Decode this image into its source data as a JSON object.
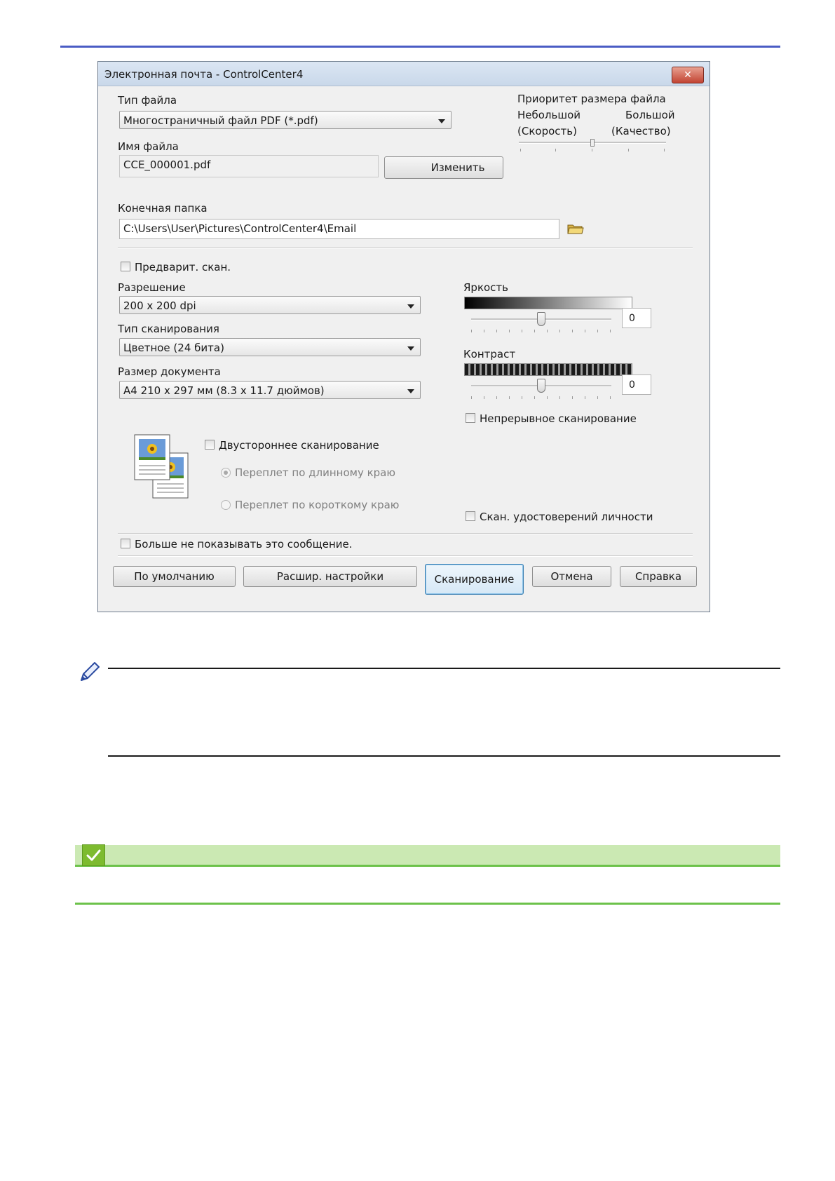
{
  "dialog": {
    "title": "Электронная почта - ControlCenter4",
    "close_label": "✕",
    "file_type": {
      "label": "Тип файла",
      "value": "Многостраничный файл PDF (*.pdf)"
    },
    "file_name": {
      "label": "Имя файла",
      "value": "CCE_000001.pdf",
      "change_button": "Изменить"
    },
    "file_size_priority": {
      "label": "Приоритет размера файла",
      "small": "Небольшой",
      "small_sub": "(Скорость)",
      "large": "Большой",
      "large_sub": "(Качество)",
      "level_fraction": 0.5
    },
    "destination": {
      "label": "Конечная папка",
      "path": "C:\\Users\\User\\Pictures\\ControlCenter4\\Email",
      "folder_icon": "folder-icon"
    },
    "prescan": {
      "label": "Предварит. скан.",
      "checked": false
    },
    "resolution": {
      "label": "Разрешение",
      "value": "200 x 200  dpi"
    },
    "scan_type": {
      "label": "Тип сканирования",
      "value": "Цветное (24 бита)"
    },
    "document_size": {
      "label": "Размер документа",
      "value": "A4 210 x 297 мм (8.3 x 11.7 дюймов)"
    },
    "brightness": {
      "label": "Яркость",
      "value": "0",
      "level_fraction": 0.5
    },
    "contrast": {
      "label": "Контраст",
      "value": "0",
      "level_fraction": 0.5
    },
    "continuous_scan": {
      "label": "Непрерывное сканирование",
      "checked": false
    },
    "duplex": {
      "label": "Двустороннее сканирование",
      "checked": false,
      "long_edge": "Переплет по длинному краю",
      "short_edge": "Переплет по короткому краю",
      "selected": "long_edge"
    },
    "id_card_scan": {
      "label": "Скан. удостоверений личности",
      "checked": false
    },
    "dont_show": {
      "label": "Больше не показывать это сообщение.",
      "checked": false
    },
    "buttons": {
      "default": "По умолчанию",
      "advanced": "Расшир. настройки",
      "scan": "Сканирование",
      "cancel": "Отмена",
      "help": "Справка"
    }
  },
  "colors": {
    "top_rule": "#4a5cc4",
    "green_accent": "#6cc24a",
    "green_bar": "#cbe9b3"
  },
  "icons": {
    "note": "pencil-icon",
    "tip": "checkmark-icon",
    "duplex_preview": "duplex-pages-icon"
  }
}
